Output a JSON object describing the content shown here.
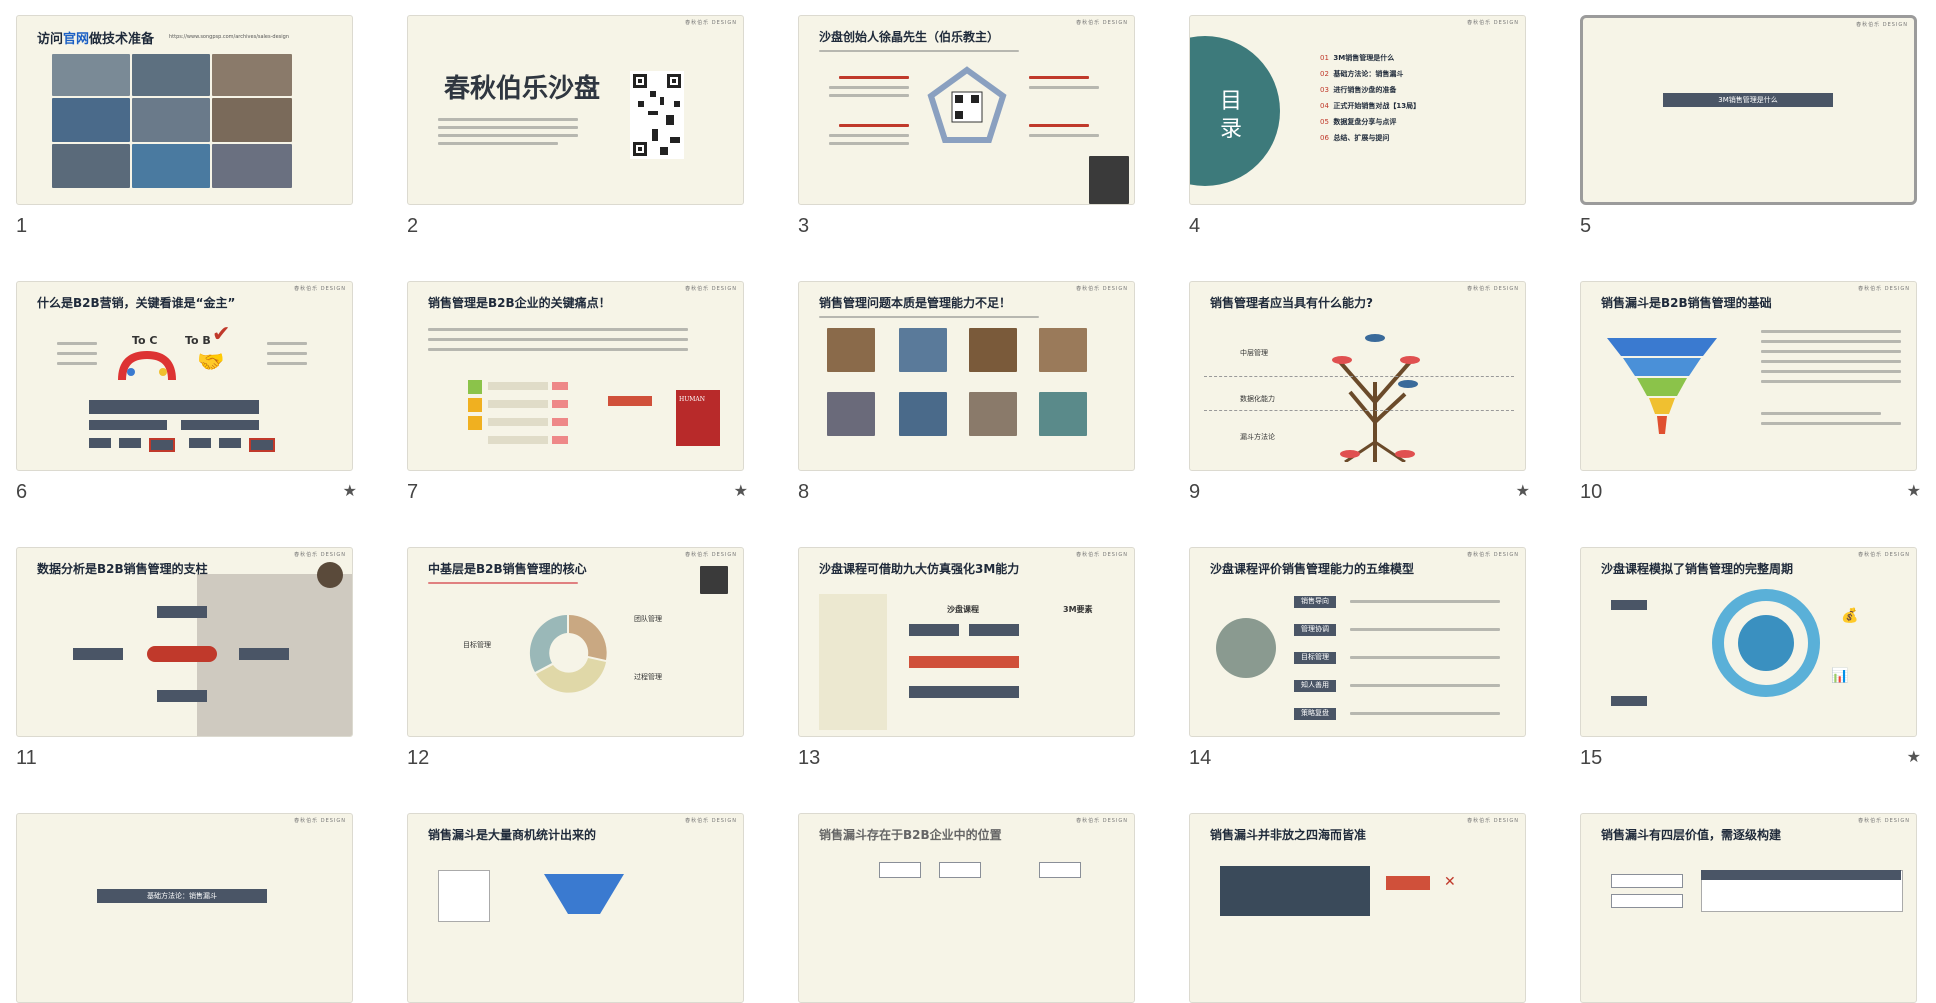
{
  "slides": [
    {
      "num": "1",
      "title_pre": "访问",
      "title_hl": "官网",
      "title_post": "做技术准备",
      "url": "https://www.songpsp.com/archives/sales-design",
      "star": ""
    },
    {
      "num": "2",
      "title": "春秋伯乐沙盘",
      "star": ""
    },
    {
      "num": "3",
      "title": "沙盘创始人徐晶先生（伯乐教主）",
      "star": ""
    },
    {
      "num": "4",
      "title": "目录",
      "items": [
        "3M销售管理是什么",
        "基础方法论：销售漏斗",
        "进行销售沙盘的准备",
        "正式开始销售对战【13局】",
        "数据复盘分享与点评",
        "总结、扩展与提问"
      ],
      "star": ""
    },
    {
      "num": "5",
      "title": "3M销售管理是什么",
      "star": ""
    },
    {
      "num": "6",
      "title": "什么是B2B营销，关键看谁是“金主”",
      "to_c": "To C",
      "to_b": "To B",
      "star": "★"
    },
    {
      "num": "7",
      "title": "销售管理是B2B企业的关键痛点！",
      "star": "★"
    },
    {
      "num": "8",
      "title": "销售管理问题本质是管理能力不足！",
      "star": ""
    },
    {
      "num": "9",
      "title": "销售管理者应当具有什么能力?",
      "labels": [
        "中层管理",
        "数据化能力",
        "漏斗方法论"
      ],
      "star": "★"
    },
    {
      "num": "10",
      "title": "销售漏斗是B2B销售管理的基础",
      "star": "★"
    },
    {
      "num": "11",
      "title": "数据分析是B2B销售管理的支柱",
      "star": ""
    },
    {
      "num": "12",
      "title": "中基层是B2B销售管理的核心",
      "labels": [
        "目标管理",
        "团队管理",
        "过程管理"
      ],
      "star": ""
    },
    {
      "num": "13",
      "title": "沙盘课程可借助九大仿真强化3M能力",
      "labels": [
        "沙盘课程",
        "3M要素"
      ],
      "star": ""
    },
    {
      "num": "14",
      "title": "沙盘课程评价销售管理能力的五维模型",
      "labels": [
        "销售导向",
        "管理协调",
        "目标管理",
        "知人善用",
        "策略复盘"
      ],
      "star": ""
    },
    {
      "num": "15",
      "title": "沙盘课程模拟了销售管理的完整周期",
      "star": "★"
    },
    {
      "num": "16",
      "title": "基础方法论：销售漏斗",
      "star": ""
    },
    {
      "num": "17",
      "title": "销售漏斗是大量商机统计出来的",
      "star": ""
    },
    {
      "num": "18",
      "title": "销售漏斗存在于B2B企业中的位置",
      "star": ""
    },
    {
      "num": "19",
      "title": "销售漏斗并非放之四海而皆准",
      "star": ""
    },
    {
      "num": "20",
      "title": "销售漏斗有四层价值，需逐级构建",
      "star": ""
    }
  ],
  "brand": "春秋伯乐 DESIGN",
  "colors": {
    "slide_bg": "#f6f4e7",
    "accent_red": "#c0392b",
    "dark": "#4a5566",
    "teal": "#3d7a7b"
  }
}
